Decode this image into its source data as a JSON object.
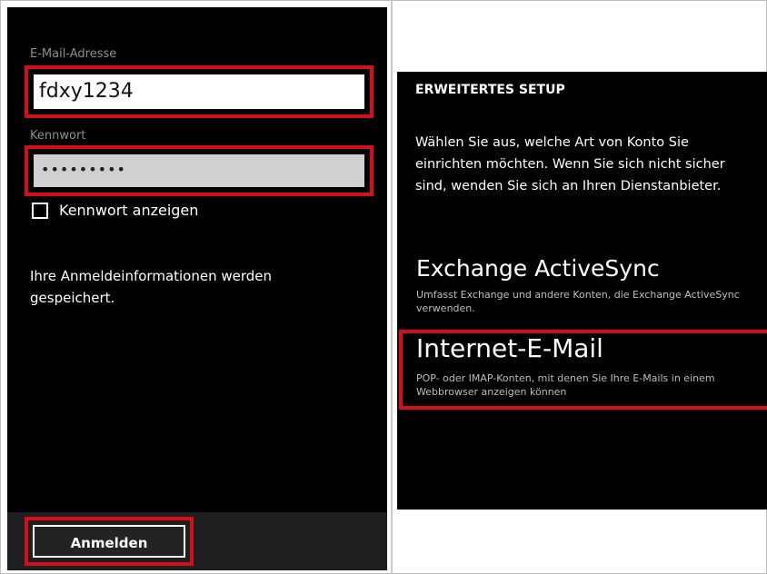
{
  "left_screen": {
    "email": {
      "label": "E-Mail-Adresse",
      "value": "fdxy1234"
    },
    "password": {
      "label": "Kennwort",
      "value": "•••••••••"
    },
    "show_password_label": "Kennwort anzeigen",
    "info_text": "Ihre Anmeldeinformationen werden gespeichert.",
    "login_button": "Anmelden"
  },
  "right_screen": {
    "title": "ERWEITERTES SETUP",
    "description": "Wählen Sie aus, welche Art von Konto Sie einrichten möchten. Wenn Sie sich nicht sicher sind, wenden Sie sich an Ihren Dienstanbieter.",
    "options": [
      {
        "title": "Exchange ActiveSync",
        "subtitle": "Umfasst Exchange und andere Konten, die Exchange ActiveSync verwenden."
      },
      {
        "title": "Internet-E-Mail",
        "subtitle": "POP- oder IMAP-Konten, mit denen Sie Ihre E-Mails in einem Webbrowser anzeigen können"
      }
    ]
  },
  "colors": {
    "highlight": "#d40f1b",
    "background": "#000000"
  }
}
